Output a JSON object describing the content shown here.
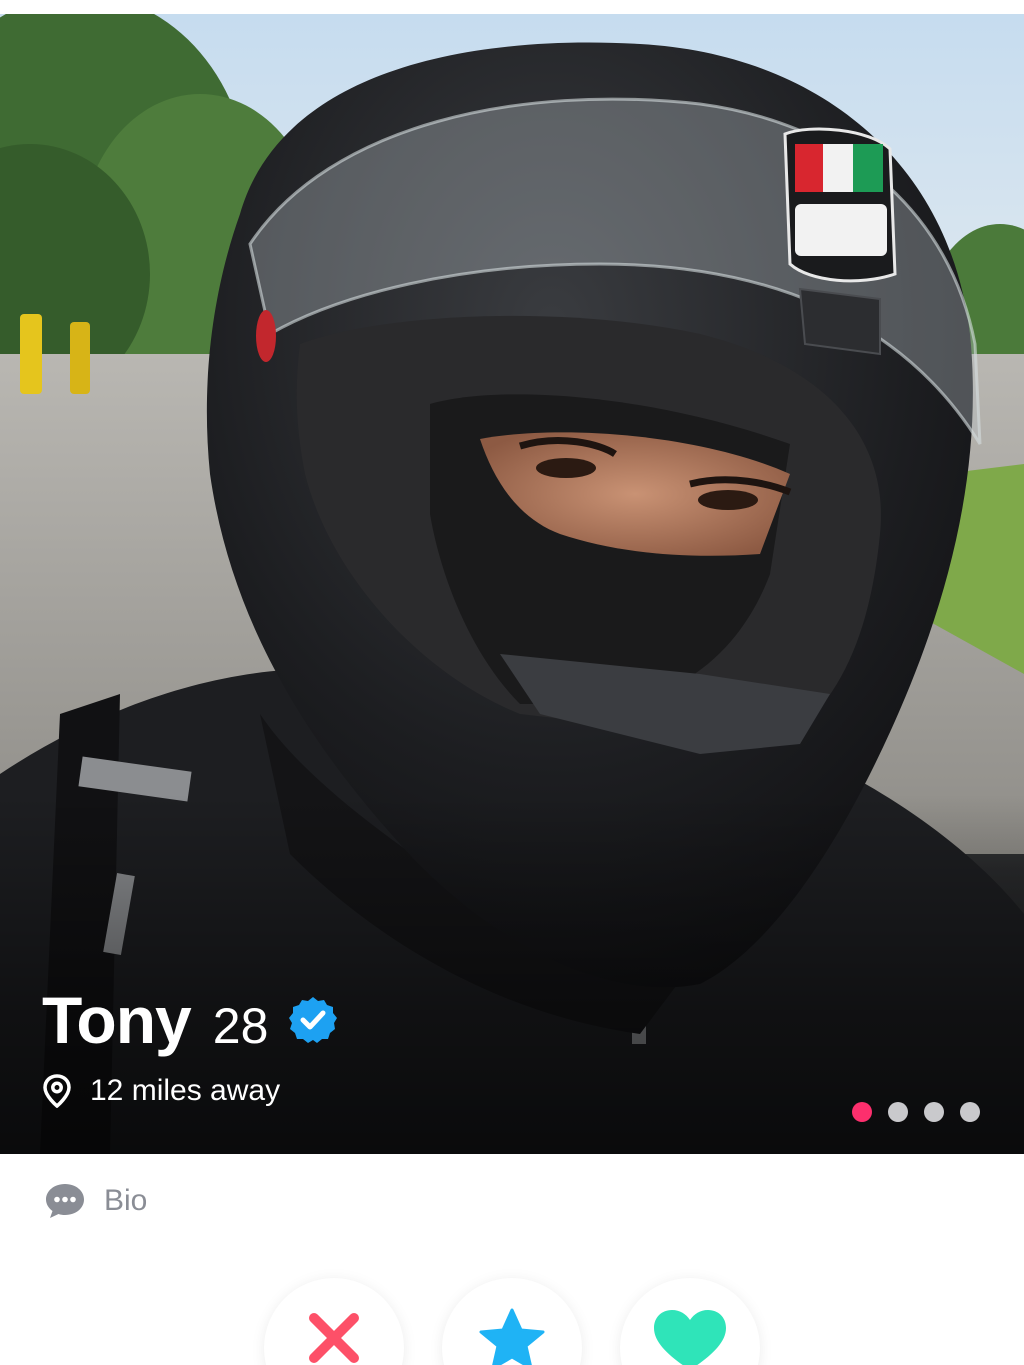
{
  "profile": {
    "name": "Tony",
    "age": "28",
    "verified_icon": "verified-badge-icon",
    "distance": "12 miles away",
    "photo_count": 4,
    "active_photo_index": 0
  },
  "bio": {
    "label": "Bio",
    "icon": "chat-bubble-icon"
  },
  "actions": {
    "nope_icon": "close-icon",
    "super_like_icon": "star-icon",
    "like_icon": "heart-icon"
  },
  "colors": {
    "accent_pink": "#fd2f6d",
    "verified_blue": "#1da1f2",
    "nope_red": "#fd5068",
    "super_like_blue": "#1fb3f5",
    "like_green": "#2fe4b9",
    "inactive_dot": "#c9c9cc",
    "bio_gray": "#8a8d95"
  }
}
